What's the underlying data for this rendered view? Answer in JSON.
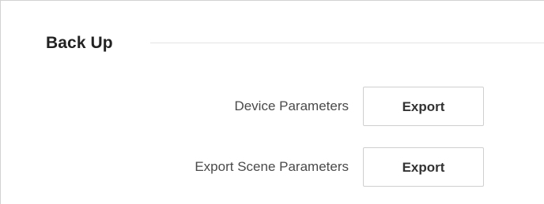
{
  "backup": {
    "title": "Back Up",
    "rows": [
      {
        "label": "Device Parameters",
        "button_label": "Export"
      },
      {
        "label": "Export Scene Parameters",
        "button_label": "Export"
      }
    ]
  },
  "colors": {
    "border": "#d2d2d2",
    "divider": "#e4e4e4",
    "title_text": "#222222",
    "label_text": "#4a4a4a",
    "button_text": "#333333",
    "button_border": "#cfcfcf"
  }
}
